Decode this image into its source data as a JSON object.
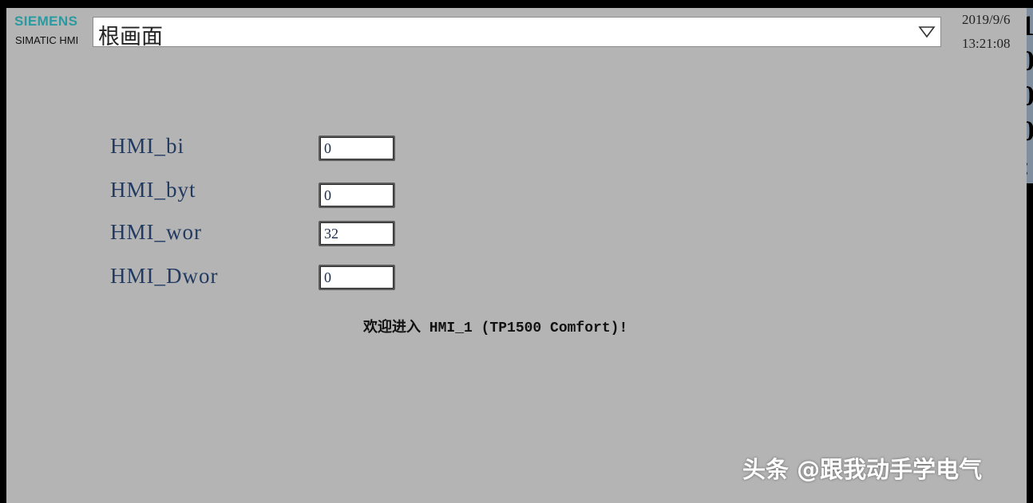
{
  "header": {
    "brand": "SIEMENS",
    "product": "SIMATIC HMI",
    "screen_name": "根画面",
    "date": "2019/9/6",
    "time": "13:21:08"
  },
  "fields": [
    {
      "label": "HMI_bi",
      "value": "0"
    },
    {
      "label": "HMI_byt",
      "value": "0"
    },
    {
      "label": "HMI_wor",
      "value": "32"
    },
    {
      "label": "HMI_Dwor",
      "value": "0"
    }
  ],
  "welcome_text": "欢迎进入 HMI_1 (TP1500 Comfort)!",
  "watermark": "头条 @跟我动手学电气",
  "colors": {
    "background": "#b4b4b4",
    "brand": "#2a9aa0",
    "label": "#223a60"
  },
  "icons": {
    "dropdown": "chevron-down-outline-icon"
  }
}
